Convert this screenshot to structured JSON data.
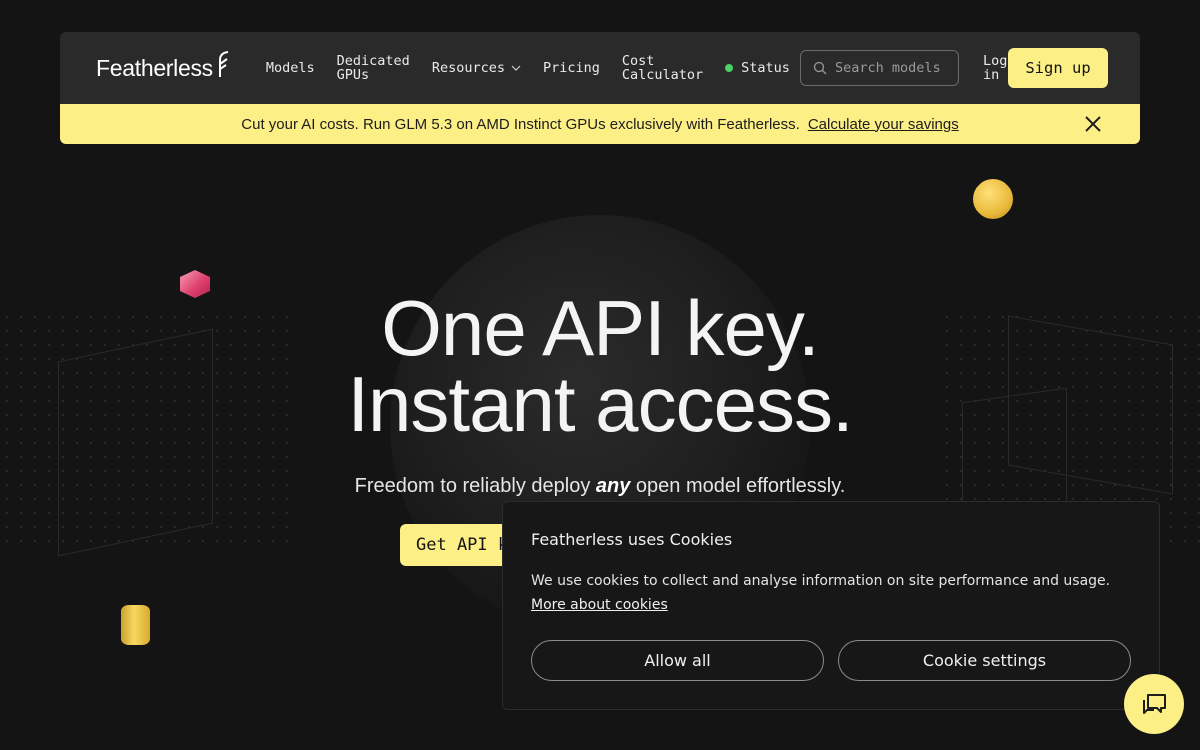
{
  "brand": {
    "name": "Featherless",
    "logo_icon": "feather-f-icon"
  },
  "nav": {
    "links": [
      {
        "label": "Models"
      },
      {
        "label_line1": "Dedicated",
        "label_line2": "GPUs"
      },
      {
        "label": "Resources",
        "icon": "chevron-down-icon"
      },
      {
        "label": "Pricing"
      },
      {
        "label_line1": "Cost",
        "label_line2": "Calculator"
      }
    ],
    "status_label": "Status",
    "status_color": "#4ed164",
    "search_placeholder": "Search models",
    "login_line1": "Log",
    "login_line2": "in",
    "signup_label": "Sign up"
  },
  "banner": {
    "text": "Cut your AI costs. Run GLM 5.3 on AMD Instinct GPUs exclusively with Featherless.",
    "link_label": "Calculate your savings",
    "background": "#fcef86"
  },
  "hero": {
    "title_line1": "One API key.",
    "title_line2": "Instant access.",
    "subtitle_before": "Freedom to reliably deploy ",
    "subtitle_emphasis": "any",
    "subtitle_after": " open model effortlessly.",
    "cta_label": "Get API k"
  },
  "cookie": {
    "title": "Featherless uses Cookies",
    "body": "We use cookies to collect and analyse information on site performance and usage.",
    "link_label": "More about cookies",
    "allow_label": "Allow all",
    "settings_label": "Cookie settings"
  },
  "chat": {
    "icon": "chat-bubbles-icon"
  }
}
